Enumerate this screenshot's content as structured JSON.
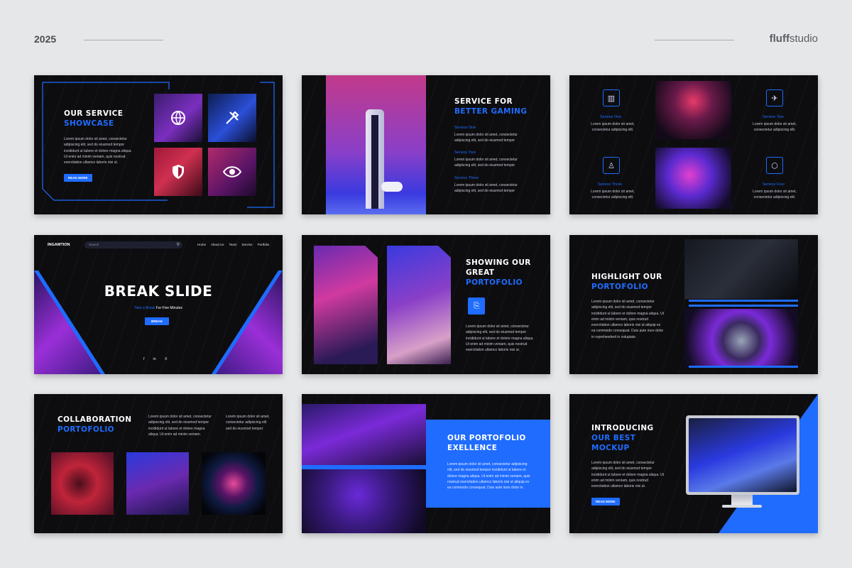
{
  "header": {
    "year": "2025",
    "brand_bold": "fluff",
    "brand_rest": "studio"
  },
  "slide1": {
    "title": "OUR SERVICE",
    "title_accent": "SHOWCASE",
    "body": "Lorem ipsum dolor sit amet, consectetur adipiscing elit, sed do eiusmod tempor incididunt ut labore et dolore magna aliqua. Ut enim ad minim veniam, quis nostrud exercitation ullamco laboris nisi ut.",
    "button": "READ MORE"
  },
  "slide2": {
    "title": "SERVICE FOR",
    "title_accent": "BETTER GAMING",
    "items": [
      {
        "label": "Service One",
        "text": "Lorem ipsum dolor sit amet, consectetur adipiscing elit, sed do eiusmod tempor"
      },
      {
        "label": "Service Two",
        "text": "Lorem ipsum dolor sit amet, consectetur adipiscing elit, sed do eiusmod tempor"
      },
      {
        "label": "Service Three",
        "text": "Lorem ipsum dolor sit amet, consectetur adipiscing elit, sed do eiusmod tempor"
      }
    ]
  },
  "slide3": {
    "items": [
      {
        "label": "Service One",
        "text": "Lorem ipsum dolor sit amet, consectetur adipiscing elit."
      },
      {
        "label": "Service Two",
        "text": "Lorem ipsum dolor sit amet, consectetur adipiscing elit."
      },
      {
        "label": "Service Three",
        "text": "Lorem ipsum dolor sit amet, consectetur adipiscing elit."
      },
      {
        "label": "Service Four",
        "text": "Lorem ipsum dolor sit amet, consectetur adipiscing elit."
      }
    ]
  },
  "slide4": {
    "logo": "INGAMTION",
    "search_placeholder": "Search",
    "nav": [
      "Home",
      "About Us",
      "Team",
      "Service",
      "Portfolio"
    ],
    "title": "BREAK SLIDE",
    "tag_prefix": "Take a Break",
    "tag_suffix": " For Five Minutes",
    "button": "BREAK",
    "socials": [
      "f",
      "in",
      "X"
    ]
  },
  "slide5": {
    "title": "SHOWING OUR",
    "title2": "GREAT",
    "title_accent": "PORTOFOLIO",
    "body": "Lorem ipsum dolor sit amet, consectetur adipiscing elit, sed do eiusmod tempor incididunt ut labore et dolore magna aliqua. Ut enim ad minim veniam, quis nostrud exercitation ullamco laboris nisi ut."
  },
  "slide6": {
    "title": "HIGHLIGHT OUR",
    "title_accent": "PORTOFOLIO",
    "body": "Lorem ipsum dolor sit amet, consectetur adipiscing elit, sed do eiusmod tempor incididunt ut labore et dolore magna aliqua. Ut enim ad minim veniam, quis nostrud exercitation ullamco laboris nisi ut aliquip ex ea commodo consequat. Duis aute irure dolor in reprehenderit in voluptate."
  },
  "slide7": {
    "title": "COLLABORATION",
    "title_accent": "PORTOFOLIO",
    "col1": "Lorem ipsum dolor sit amet, consectetur adipiscing elit, sed do eiusmod tempor incididunt ut labore et dolore magna aliqua. Ut enim ad minim veniam.",
    "col2": "Lorem ipsum dolor sit amet, consectetur adipiscing elit sed do eiusmod tempor"
  },
  "slide8": {
    "title": "OUR PORTOFOLIO",
    "title_accent": "EXELLENCE",
    "body": "Lorem ipsum dolor sit amet, consectetur adipiscing elit, sed do eiusmod tempor incididunt ut labore et dolore magna aliqua. Ut enim ad minim veniam, quis nostrud exercitation ullamco laboris nisi ut aliquip ex ea commodo consequat. Duis aute irure dolor in."
  },
  "slide9": {
    "title": "INTRODUCING",
    "title2": "OUR BEST",
    "title_accent": "MOCKUP",
    "body": "Lorem ipsum dolor sit amet, consectetur adipiscing elit, sed do eiusmod tempor incididunt ut labore et dolore magna aliqua. Ut enim ad minim veniam, quis nostrud exercitation ullamco laboris nisi ut.",
    "button": "READ MORE"
  },
  "colors": {
    "accent": "#1f6cff",
    "slide_bg": "#0d0d10",
    "canvas_bg": "#e6e7e9"
  }
}
